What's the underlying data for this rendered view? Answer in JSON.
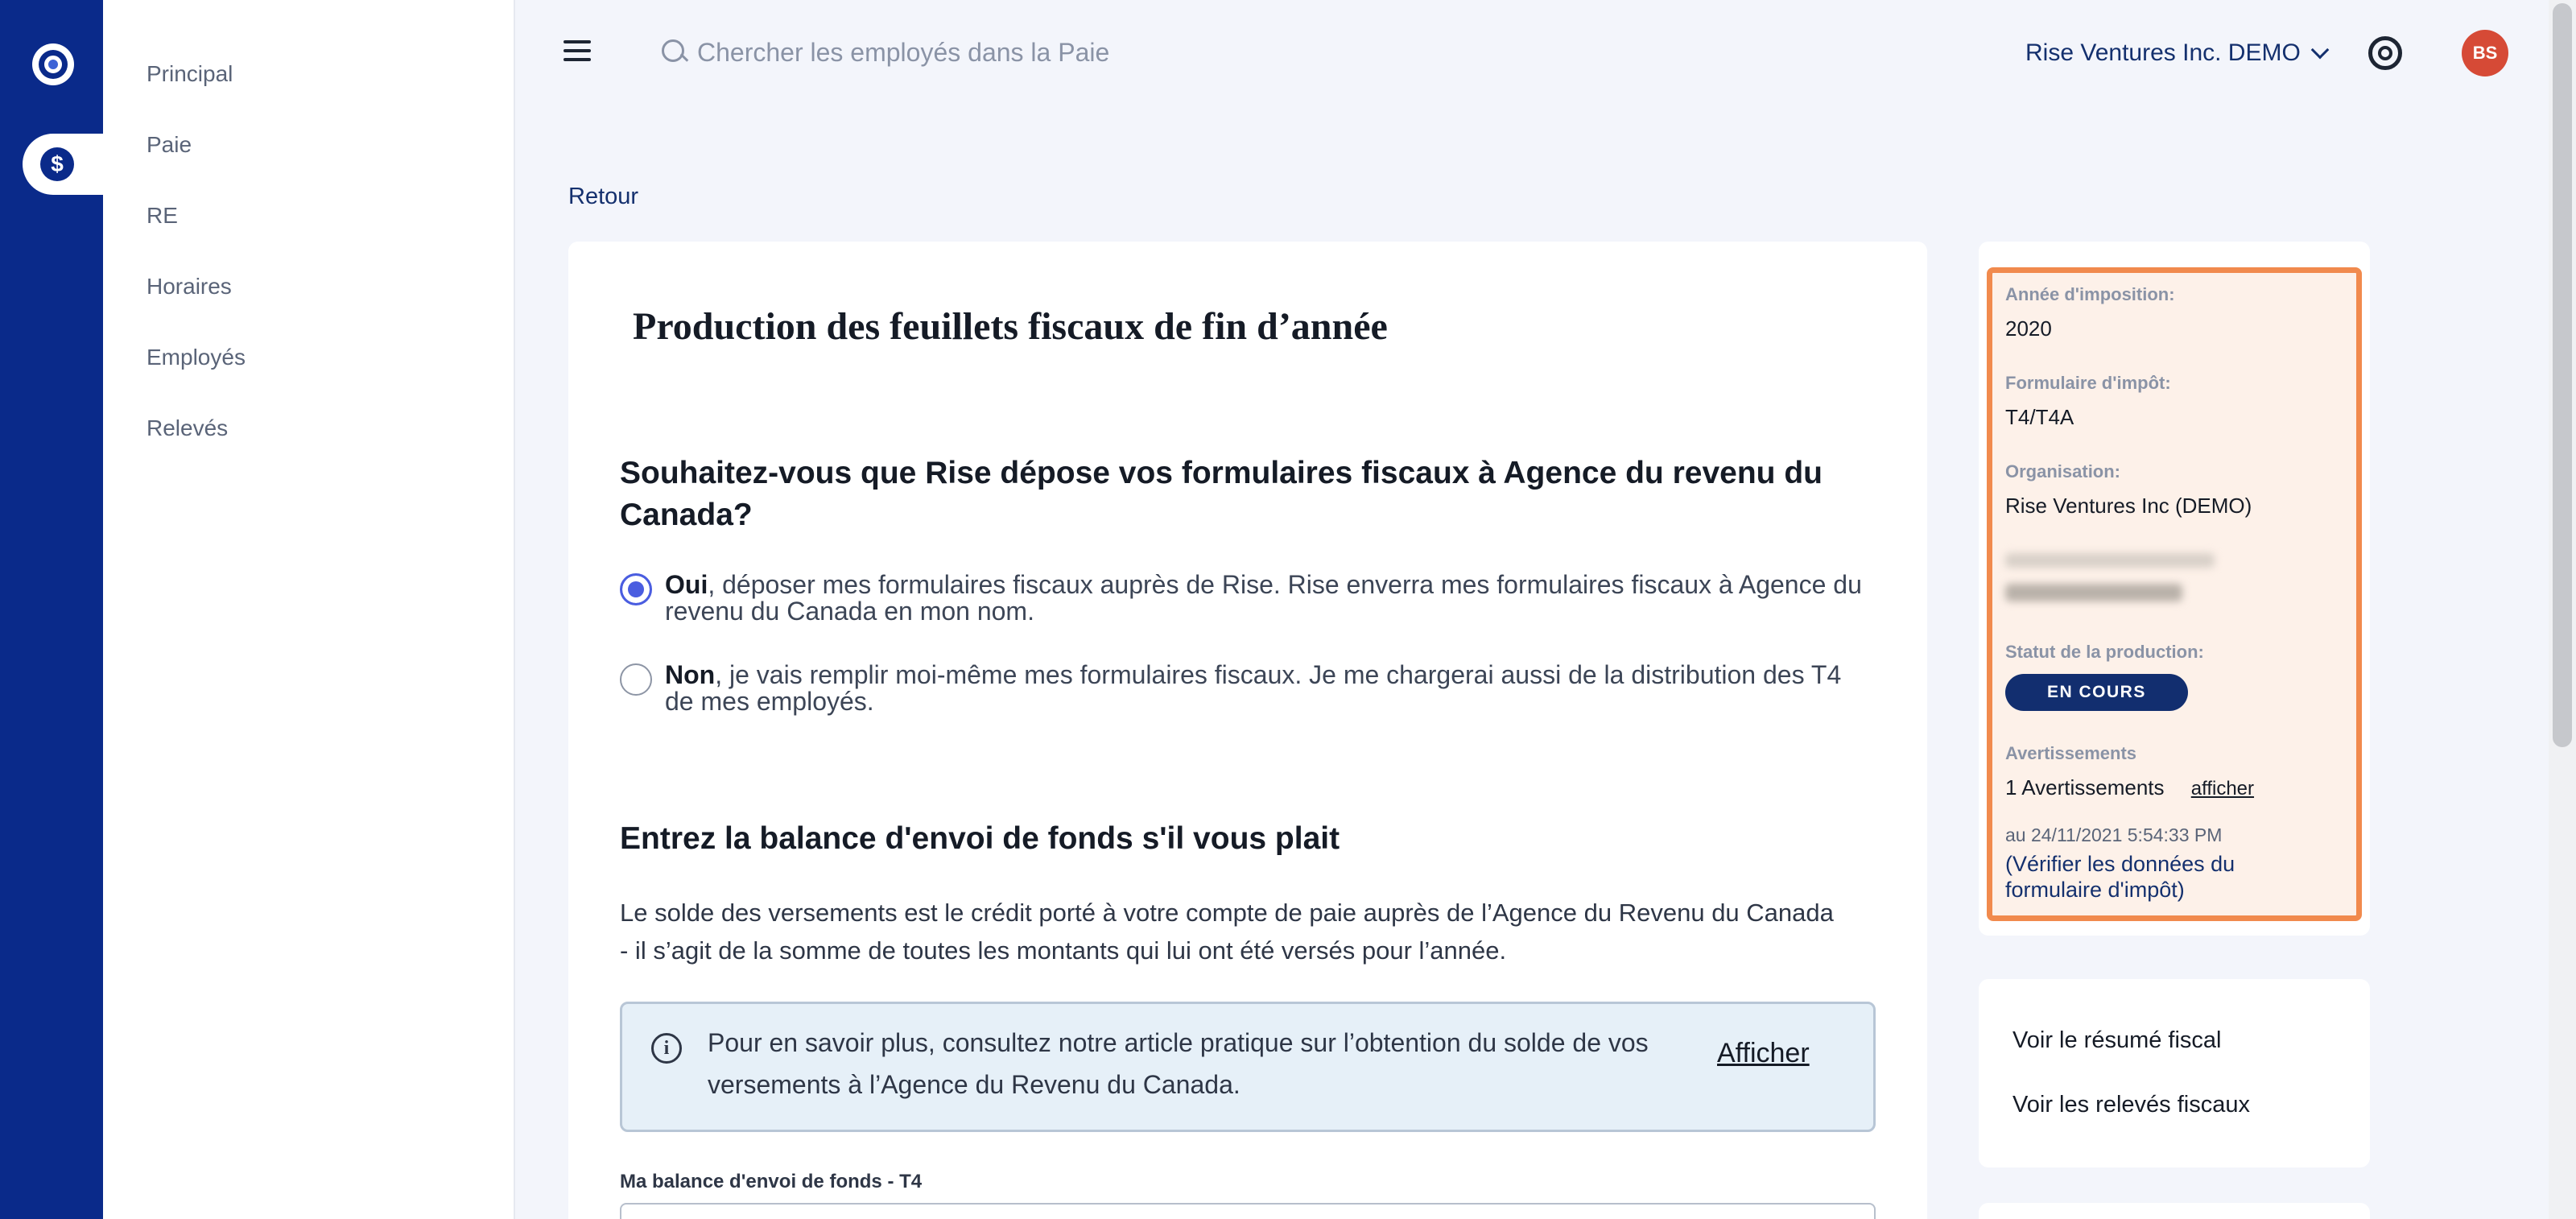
{
  "sidebar": {
    "items": [
      {
        "label": "Principal"
      },
      {
        "label": "Paie"
      },
      {
        "label": "RE"
      },
      {
        "label": "Horaires"
      },
      {
        "label": "Employés"
      },
      {
        "label": "Relevés"
      }
    ]
  },
  "topbar": {
    "search_placeholder": "Chercher les employés dans la Paie",
    "org_name": "Rise Ventures Inc. DEMO",
    "avatar_initials": "BS"
  },
  "back_label": "Retour",
  "main": {
    "title": "Production des feuillets fiscaux de fin d’année",
    "question": "Souhaitez-vous que Rise dépose vos formulaires fiscaux à Agence du revenu du Canada?",
    "options": [
      {
        "strong": "Oui",
        "text": ", déposer mes formulaires fiscaux auprès de Rise. Rise enverra mes formulaires fiscaux à Agence du revenu du Canada en mon nom.",
        "selected": true
      },
      {
        "strong": "Non",
        "text": ", je vais remplir moi-même mes formulaires fiscaux. Je me chargerai aussi de la distribution des T4 de mes employés.",
        "selected": false
      }
    ],
    "balance_heading": "Entrez la balance d'envoi de fonds s'il vous plait",
    "balance_paragraph": "Le solde des versements est le crédit porté à votre compte de paie auprès de l’Agence du Revenu du Canada - il s’agit de la somme de toutes les montants qui lui ont été versés pour l’année.",
    "info_text": "Pour en savoir plus, consultez notre article pratique sur l’obtention du solde de vos versements à l’Agence du Revenu du Canada.",
    "info_link": "Afficher",
    "field_label": "Ma balance d'envoi de fonds - T4"
  },
  "status": {
    "tax_year_label": "Année d'imposition:",
    "tax_year": "2020",
    "form_label": "Formulaire d'impôt:",
    "form": "T4/T4A",
    "org_label": "Organisation:",
    "org": "Rise Ventures Inc (DEMO)",
    "filing_label": "Statut de la production:",
    "filing_status": "EN COURS",
    "warnings_label": "Avertissements",
    "warnings_count": "1 Avertissements",
    "warnings_link": "afficher",
    "as_of": "au 24/11/2021 5:54:33 PM",
    "verify_open": "(",
    "verify_link": "Vérifier les données du formulaire d'impôt",
    "verify_close": ")",
    "accent_color": "#f18a4d"
  },
  "links": [
    {
      "label": "Voir le résumé fiscal"
    },
    {
      "label": "Voir les relevés fiscaux"
    }
  ]
}
